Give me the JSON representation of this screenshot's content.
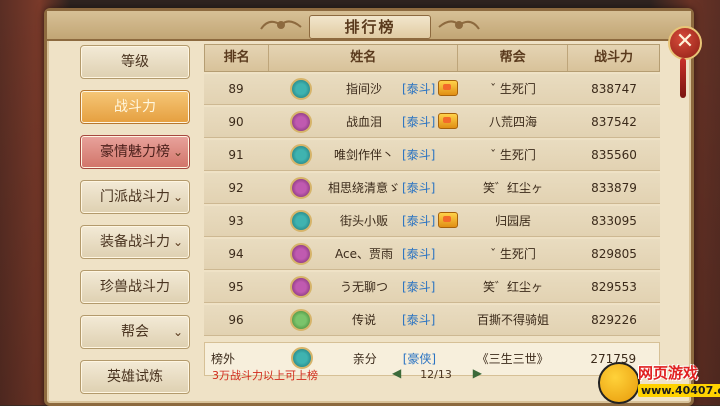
{
  "window": {
    "title": "排行榜",
    "close_label": "✕"
  },
  "sidebar": {
    "items": [
      {
        "label": "等级",
        "state": "normal",
        "chevron": ""
      },
      {
        "label": "战斗力",
        "state": "active",
        "chevron": ""
      },
      {
        "label": "豪情魅力榜",
        "state": "selected",
        "chevron": "⌄"
      },
      {
        "label": "门派战斗力",
        "state": "normal",
        "chevron": "⌄"
      },
      {
        "label": "装备战斗力",
        "state": "normal",
        "chevron": "⌄"
      },
      {
        "label": "珍兽战斗力",
        "state": "normal",
        "chevron": ""
      },
      {
        "label": "帮会",
        "state": "normal",
        "chevron": "⌄"
      },
      {
        "label": "英雄试炼",
        "state": "normal",
        "chevron": ""
      }
    ]
  },
  "table": {
    "headers": {
      "rank": "排名",
      "name": "姓名",
      "guild": "帮会",
      "power": "战斗力"
    },
    "rows": [
      {
        "rank": "89",
        "avatar": "teal",
        "name": "指间沙",
        "faction": "[泰斗]",
        "crown": true,
        "guild": "ˇ 生死门",
        "power": "838747"
      },
      {
        "rank": "90",
        "avatar": "purple",
        "name": "战血泪",
        "faction": "[泰斗]",
        "crown": true,
        "guild": "八荒四海",
        "power": "837542"
      },
      {
        "rank": "91",
        "avatar": "teal",
        "name": "唯剑作伴丶",
        "faction": "[泰斗]",
        "crown": false,
        "guild": "ˇ 生死门",
        "power": "835560"
      },
      {
        "rank": "92",
        "avatar": "purple",
        "name": "相思绕清意ゞ",
        "faction": "[泰斗]",
        "crown": false,
        "guild": "笑゛红尘ヶ",
        "power": "833879"
      },
      {
        "rank": "93",
        "avatar": "teal",
        "name": "街头小贩",
        "faction": "[泰斗]",
        "crown": true,
        "guild": "归园居",
        "power": "833095"
      },
      {
        "rank": "94",
        "avatar": "purple",
        "name": "Ace、贾雨",
        "faction": "[泰斗]",
        "crown": false,
        "guild": "ˇ 生死门",
        "power": "829805"
      },
      {
        "rank": "95",
        "avatar": "purple",
        "name": "う无聊つ",
        "faction": "[泰斗]",
        "crown": false,
        "guild": "笑゛红尘ヶ",
        "power": "829553"
      },
      {
        "rank": "96",
        "avatar": "green",
        "name": "传说",
        "faction": "[泰斗]",
        "crown": false,
        "guild": "百撕不得骑姐",
        "power": "829226"
      }
    ],
    "self_row": {
      "rank": "榜外",
      "avatar": "teal",
      "name": "亲分",
      "faction": "[豪侠]",
      "guild": "《三生三世》",
      "power": "271759"
    }
  },
  "footer": {
    "note": "3万战斗力以上可上榜",
    "page": "12/13",
    "prev": "◀",
    "next": "▶"
  },
  "watermark": {
    "line1": "网页游戏",
    "line2": "www.40407.com"
  }
}
